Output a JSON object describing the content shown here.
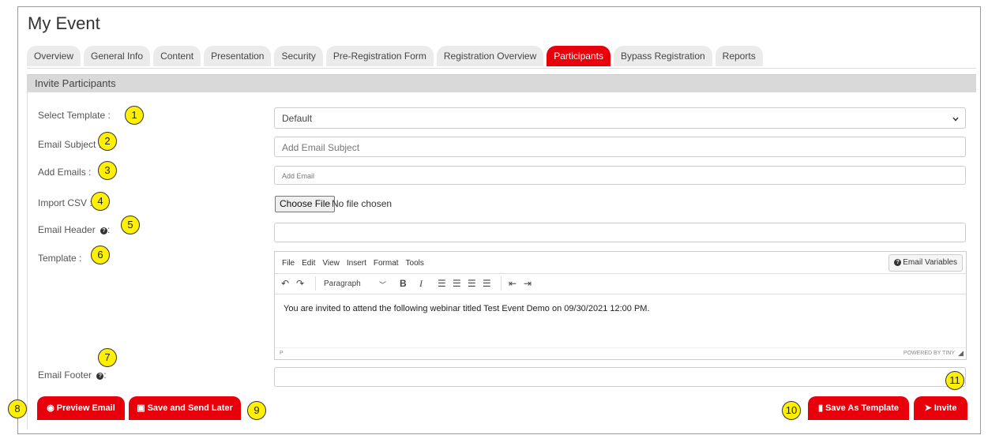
{
  "page": {
    "title": "My Event",
    "tabs": [
      "Overview",
      "General Info",
      "Content",
      "Presentation",
      "Security",
      "Pre-Registration Form",
      "Registration Overview",
      "Participants",
      "Bypass Registration",
      "Reports"
    ],
    "active_tab": "Participants"
  },
  "section": {
    "title": "Invite Participants"
  },
  "form": {
    "select_template_label": "Select Template :",
    "select_template_value": "Default",
    "email_subject_label": "Email Subject :",
    "email_subject_placeholder": "Add Email Subject",
    "add_emails_label": "Add Emails :",
    "add_emails_placeholder": "Add Email",
    "import_csv_label": "Import CSV :",
    "choose_file_label": "Choose File",
    "no_file_text": "No file chosen",
    "email_header_label": "Email Header",
    "template_label": "Template :",
    "email_footer_label": "Email Footer",
    "colon": ":"
  },
  "editor": {
    "menu": [
      "File",
      "Edit",
      "View",
      "Insert",
      "Format",
      "Tools"
    ],
    "email_variables_label": "Email Variables",
    "block_format": "Paragraph",
    "body_text": "You are invited to attend the following webinar titled Test Event Demo on 09/30/2021 12:00 PM.",
    "status_path": "P",
    "powered_by": "POWERED BY TINY"
  },
  "buttons": {
    "preview_email": "Preview Email",
    "save_send_later": "Save and Send Later",
    "save_as_template": "Save As Template",
    "invite": "Invite"
  },
  "badges": [
    "1",
    "2",
    "3",
    "4",
    "5",
    "6",
    "7",
    "8",
    "9",
    "10",
    "11"
  ],
  "colors": {
    "accent": "#e8000b",
    "badge": "#ffef00",
    "section_bar": "#d9d9d9"
  },
  "icons": [
    "chevron-down-icon",
    "question-circle-icon",
    "undo-icon",
    "redo-icon",
    "bold-icon",
    "italic-icon",
    "align-left-icon",
    "align-center-icon",
    "align-right-icon",
    "align-justify-icon",
    "outdent-icon",
    "indent-icon",
    "eye-icon",
    "save-icon",
    "file-icon",
    "paper-plane-icon",
    "resize-handle-icon"
  ]
}
